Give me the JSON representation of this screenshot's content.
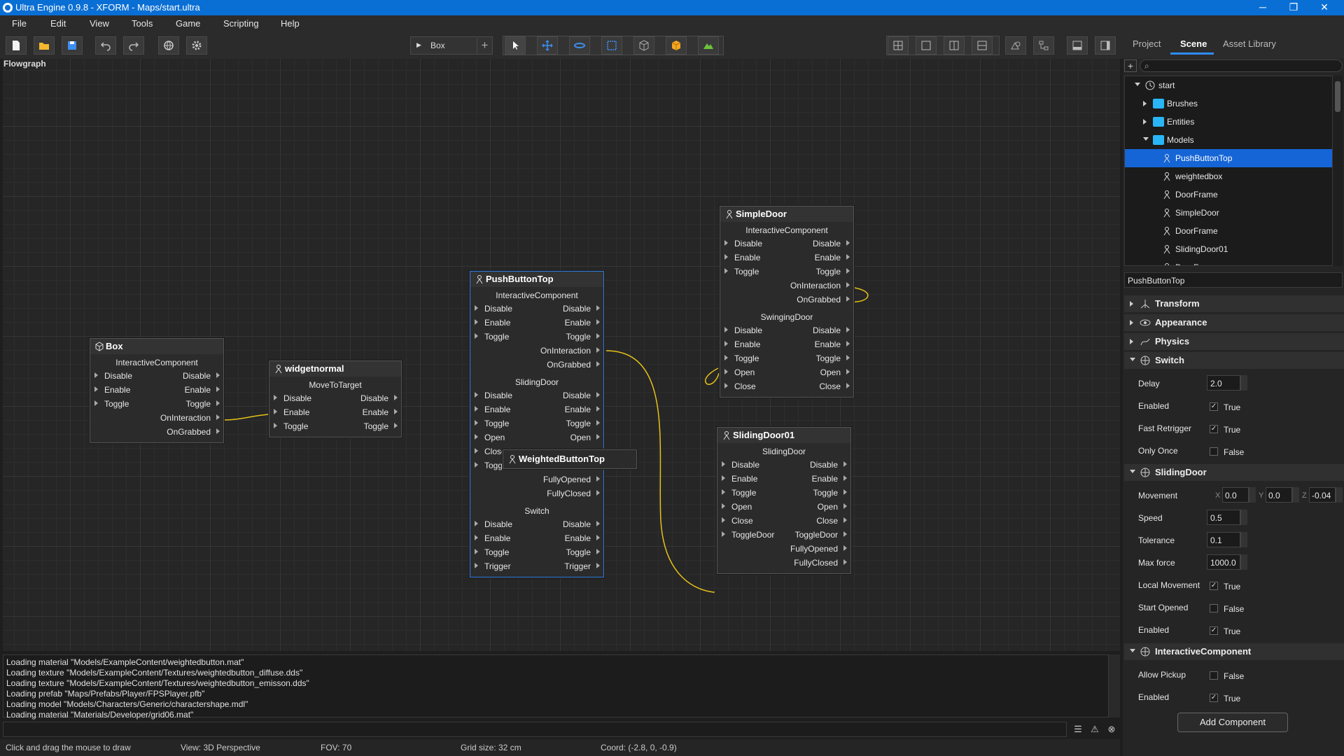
{
  "window": {
    "title": "Ultra Engine 0.9.8 - XFORM - Maps/start.ultra",
    "minimize": "─",
    "maximize": "❐",
    "close": "✕"
  },
  "menu": [
    "File",
    "Edit",
    "View",
    "Tools",
    "Game",
    "Scripting",
    "Help"
  ],
  "toolbar": {
    "object_selector": "Box",
    "add": "+"
  },
  "right_tabs": [
    "Project",
    "Scene",
    "Asset Library"
  ],
  "flowgraph": {
    "label": "Flowgraph",
    "nodes": {
      "box": {
        "title": "Box",
        "sections": [
          {
            "name": "InteractiveComponent",
            "rows": [
              [
                "Disable",
                "Disable"
              ],
              [
                "Enable",
                "Enable"
              ],
              [
                "Toggle",
                "Toggle"
              ],
              [
                "",
                "OnInteraction"
              ],
              [
                "",
                "OnGrabbed"
              ]
            ]
          }
        ]
      },
      "widget": {
        "title": "widgetnormal",
        "sections": [
          {
            "name": "MoveToTarget",
            "rows": [
              [
                "Disable",
                "Disable"
              ],
              [
                "Enable",
                "Enable"
              ],
              [
                "Toggle",
                "Toggle"
              ]
            ]
          }
        ]
      },
      "push": {
        "title": "PushButtonTop",
        "sections": [
          {
            "name": "InteractiveComponent",
            "rows": [
              [
                "Disable",
                "Disable"
              ],
              [
                "Enable",
                "Enable"
              ],
              [
                "Toggle",
                "Toggle"
              ],
              [
                "",
                "OnInteraction"
              ],
              [
                "",
                "OnGrabbed"
              ]
            ]
          },
          {
            "name": "SlidingDoor",
            "rows": [
              [
                "Disable",
                "Disable"
              ],
              [
                "Enable",
                "Enable"
              ],
              [
                "Toggle",
                "Toggle"
              ],
              [
                "Open",
                "Open"
              ],
              [
                "Close",
                ""
              ],
              [
                "Toggl",
                ""
              ],
              [
                "",
                "FullyOpened"
              ],
              [
                "",
                "FullyClosed"
              ]
            ]
          },
          {
            "name": "Switch",
            "rows": [
              [
                "Disable",
                "Disable"
              ],
              [
                "Enable",
                "Enable"
              ],
              [
                "Toggle",
                "Toggle"
              ],
              [
                "Trigger",
                "Trigger"
              ]
            ]
          }
        ]
      },
      "weighted": {
        "title": "WeightedButtonTop"
      },
      "simple": {
        "title": "SimpleDoor",
        "sections": [
          {
            "name": "InteractiveComponent",
            "rows": [
              [
                "Disable",
                "Disable"
              ],
              [
                "Enable",
                "Enable"
              ],
              [
                "Toggle",
                "Toggle"
              ],
              [
                "",
                "OnInteraction"
              ],
              [
                "",
                "OnGrabbed"
              ]
            ]
          },
          {
            "name": "SwingingDoor",
            "rows": [
              [
                "Disable",
                "Disable"
              ],
              [
                "Enable",
                "Enable"
              ],
              [
                "Toggle",
                "Toggle"
              ],
              [
                "Open",
                "Open"
              ],
              [
                "Close",
                "Close"
              ]
            ]
          }
        ]
      },
      "sliding": {
        "title": "SlidingDoor01",
        "sections": [
          {
            "name": "SlidingDoor",
            "rows": [
              [
                "Disable",
                "Disable"
              ],
              [
                "Enable",
                "Enable"
              ],
              [
                "Toggle",
                "Toggle"
              ],
              [
                "Open",
                "Open"
              ],
              [
                "Close",
                "Close"
              ],
              [
                "ToggleDoor",
                "ToggleDoor"
              ],
              [
                "",
                "FullyOpened"
              ],
              [
                "",
                "FullyClosed"
              ]
            ]
          }
        ]
      }
    },
    "wire_color": "#e6c21a"
  },
  "log": [
    "Loading material \"Models/ExampleContent/weightedbutton.mat\"",
    "Loading texture \"Models/ExampleContent/Textures/weightedbutton_diffuse.dds\"",
    "Loading texture \"Models/ExampleContent/Textures/weightedbutton_emisson.dds\"",
    "Loading prefab \"Maps/Prefabs/Player/FPSPlayer.pfb\"",
    "Loading model \"Models/Characters/Generic/charactershape.mdl\"",
    "Loading material \"Materials/Developer/grid06.mat\""
  ],
  "status": {
    "hint": "Click and drag the mouse to draw",
    "view": "View: 3D Perspective",
    "fov": "FOV: 70",
    "grid": "Grid size: 32 cm",
    "coord": "Coord: (-2.8, 0, -0.9)"
  },
  "scene_tree": [
    {
      "label": "start",
      "depth": 0,
      "kind": "scene",
      "expanded": true
    },
    {
      "label": "Brushes",
      "depth": 1,
      "kind": "folder",
      "expanded": false
    },
    {
      "label": "Entities",
      "depth": 1,
      "kind": "folder",
      "expanded": false
    },
    {
      "label": "Models",
      "depth": 1,
      "kind": "folder",
      "expanded": true
    },
    {
      "label": "PushButtonTop",
      "depth": 2,
      "kind": "model",
      "selected": true
    },
    {
      "label": "weightedbox",
      "depth": 2,
      "kind": "model"
    },
    {
      "label": "DoorFrame",
      "depth": 2,
      "kind": "model"
    },
    {
      "label": "SimpleDoor",
      "depth": 2,
      "kind": "model"
    },
    {
      "label": "DoorFrame",
      "depth": 2,
      "kind": "model"
    },
    {
      "label": "SlidingDoor01",
      "depth": 2,
      "kind": "model"
    },
    {
      "label": "DoorFrame",
      "depth": 2,
      "kind": "model"
    }
  ],
  "properties": {
    "name": "PushButtonTop",
    "groups": {
      "transform": "Transform",
      "appearance": "Appearance",
      "physics": "Physics",
      "switch": "Switch",
      "sliding": "SlidingDoor",
      "interactive": "InteractiveComponent"
    },
    "switch": {
      "delay_label": "Delay",
      "delay": "2.0",
      "enabled_label": "Enabled",
      "enabled": "True",
      "fast_label": "Fast Retrigger",
      "fast": "True",
      "once_label": "Only Once",
      "once": "False"
    },
    "sliding": {
      "movement_label": "Movement",
      "mx": "0.0",
      "my": "0.0",
      "mz": "-0.04",
      "speed_label": "Speed",
      "speed": "0.5",
      "tol_label": "Tolerance",
      "tol": "0.1",
      "force_label": "Max force",
      "force": "1000.0",
      "local_label": "Local Movement",
      "local": "True",
      "open_label": "Start Opened",
      "open": "False",
      "enabled_label": "Enabled",
      "enabled": "True"
    },
    "interactive": {
      "pickup_label": "Allow Pickup",
      "pickup": "False",
      "enabled_label": "Enabled",
      "enabled": "True"
    },
    "add_component": "Add Component"
  },
  "colors": {
    "accent": "#2d8cff",
    "titlebar": "#0a6fd4",
    "selection": "#1565d6",
    "folder": "#29b6f6"
  }
}
